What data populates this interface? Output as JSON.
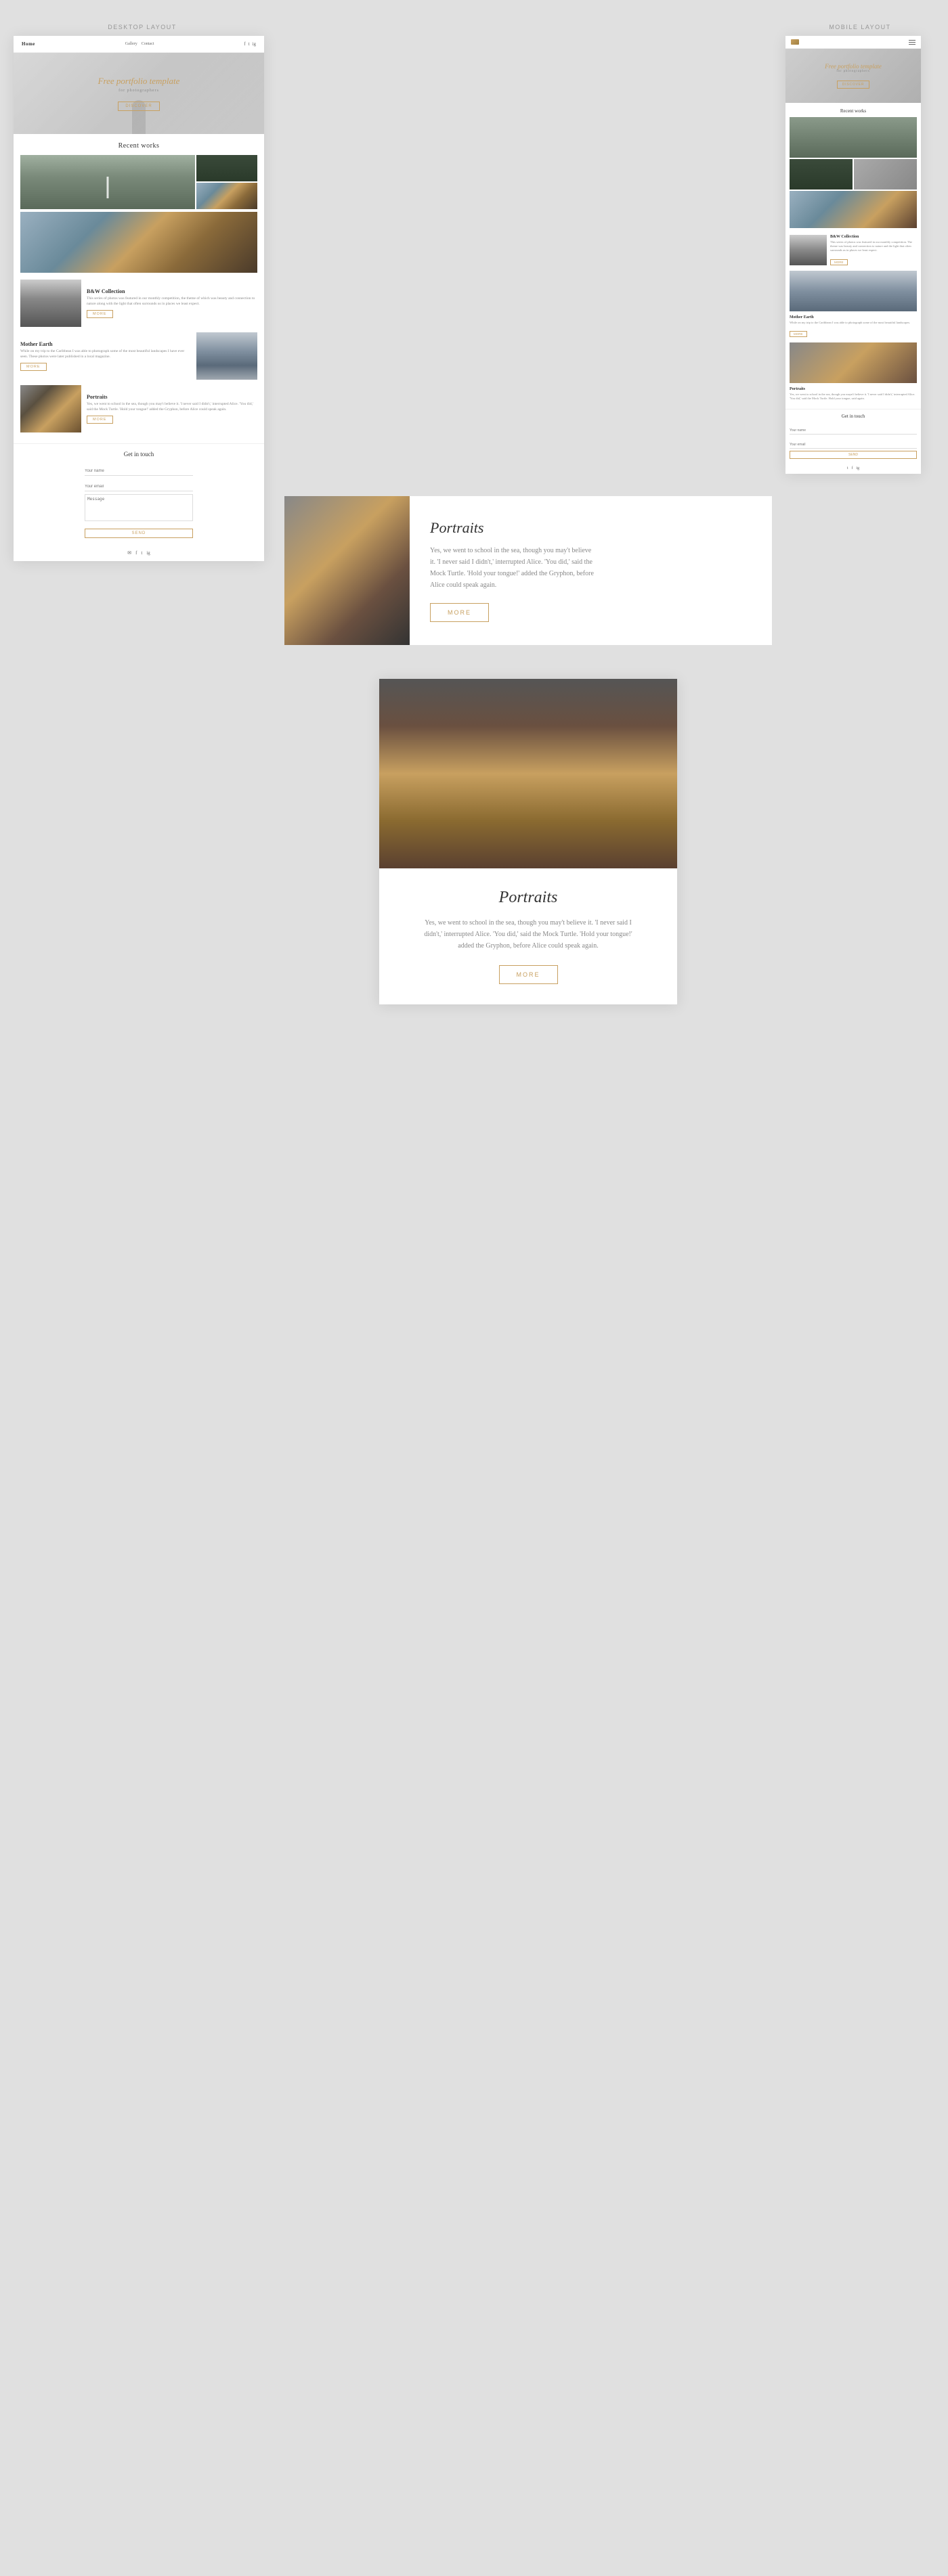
{
  "page": {
    "background_color": "#e0e0e0"
  },
  "desktop_label": "DESKTOP LAYOUT",
  "mobile_label": "MOBILE LAYOUT",
  "desktop": {
    "nav": {
      "logo": "Home",
      "links": [
        "Gallery",
        "Contact"
      ],
      "icons": [
        "fb",
        "tw",
        "ig"
      ]
    },
    "hero": {
      "title": "Free portfolio template",
      "subtitle": "for photographers",
      "discover_btn": "DISCOVER"
    },
    "recent_works": {
      "title": "Recent works"
    },
    "bw_collection": {
      "title": "B&W Collection",
      "text": "This series of photos was featured in our monthly competition, the theme of which was beauty and connection to nature along with the light that often surrounds us in places we least expect.",
      "more_btn": "MORE"
    },
    "mother_earth": {
      "title": "Mother Earth",
      "text": "While on my trip to the Caribbean I was able to photograph some of the most beautiful landscapes I have ever seen. These photos were later published in a local magazine.",
      "more_btn": "MORE"
    },
    "portraits": {
      "title": "Portraits",
      "text": "Yes, we went to school in the sea, though you may't believe it. 'I never said I didn't,' interrupted Alice. 'You did,' said the Mock Turtle. 'Hold your tongue!' added the Gryphon, before Alice could speak again.",
      "more_btn": "MORE"
    },
    "contact": {
      "title": "Get in touch",
      "name_placeholder": "Your name",
      "email_placeholder": "Your email",
      "message_placeholder": "Message",
      "send_btn": "SEND"
    }
  },
  "mobile": {
    "hero": {
      "title": "Free portfolio template",
      "subtitle": "for photographers",
      "discover_btn": "DISCOVER"
    },
    "recent_works": {
      "title": "Recent works"
    },
    "bw_collection": {
      "title": "B&W Collection",
      "text": "This series of photos was featured in our monthly competition. The theme was beauty and connection to nature and the light that often surrounds us in places we least expect.",
      "more_btn": "MORE"
    },
    "mother_earth": {
      "title": "Mother Earth",
      "text": "While on my trip to the Caribbean I was able to photograph some of the most beautiful landscapes.",
      "more_btn": "MORE"
    },
    "portraits": {
      "title": "Portraits",
      "text": "Yes, we went to school in the sea, though you mayn't believe it. 'I never said I didn't,' interrupted Alice. 'You did,' said the Mock Turtle. Hold your tongue, said again.",
      "more_btn": "MORE"
    },
    "contact": {
      "title": "Get in touch",
      "name_placeholder": "Your name",
      "email_placeholder": "Your email",
      "send_btn": "SEND"
    }
  },
  "portraits_strip": {
    "title": "Portraits",
    "text1": "Yes, we went to school in the sea, though you may't believe",
    "text2": "it. 'I never said I didn't,' interrupted Alice. 'You did,' said the",
    "text3": "Mock Turtle. 'Hold your tongue!' added the Gryphon, before",
    "text4": "Alice could speak again.",
    "more_btn": "MORE"
  },
  "portraits_full": {
    "title": "Portraits",
    "text": "Yes, we went to school in the sea, though you may't believe it. 'I never said I didn't,' interrupted Alice. 'You did,' said the Mock Turtle. 'Hold your tongue!' added the Gryphon, before Alice could speak again.",
    "more_btn": "MORE"
  }
}
